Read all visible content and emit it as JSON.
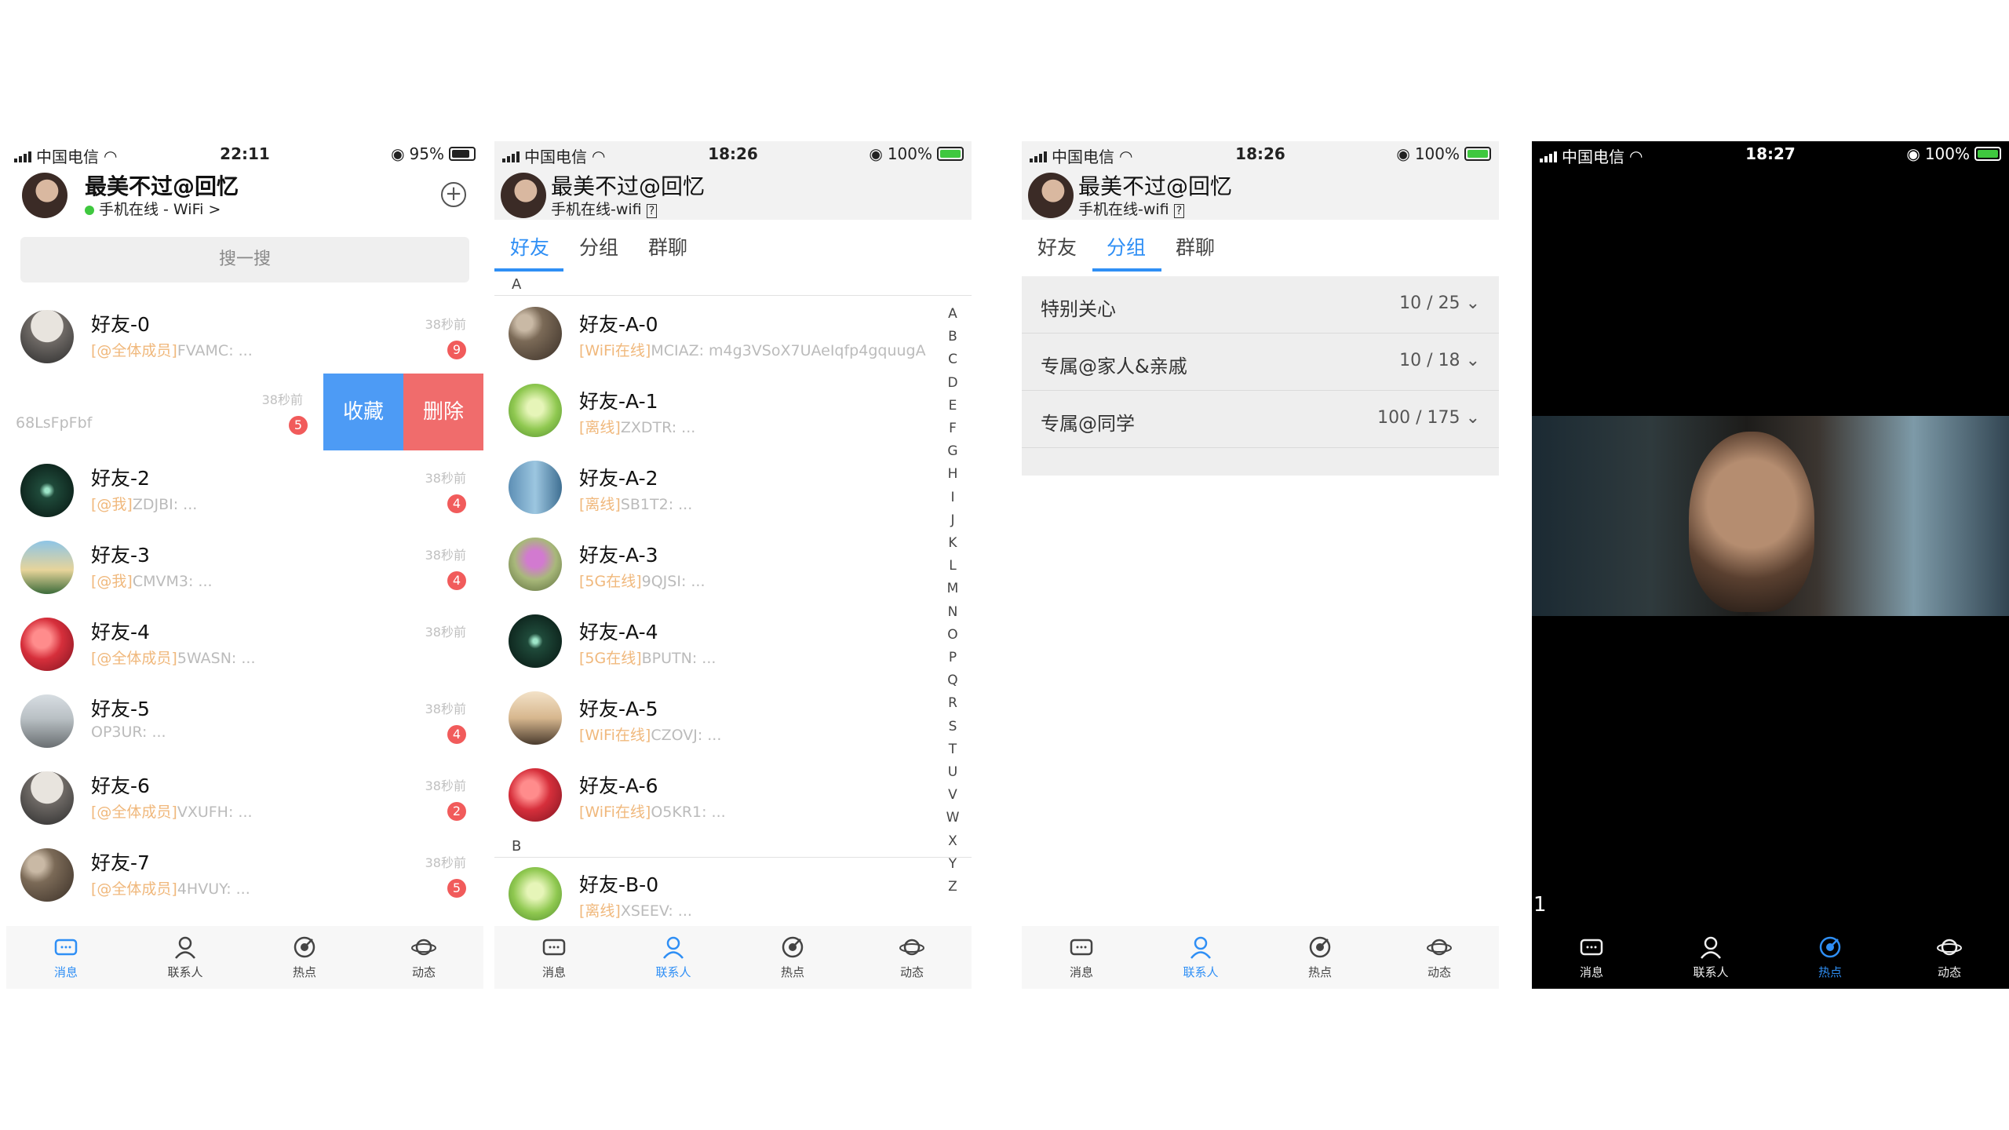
{
  "screen1": {
    "status": {
      "carrier": "中国电信",
      "time": "22:11",
      "battery": "95%"
    },
    "header": {
      "name": "最美不过@回忆",
      "status": "手机在线 - WiFi >"
    },
    "search_placeholder": "搜一搜",
    "messages": [
      {
        "name": "好友-0",
        "tag": "[@全体成员]",
        "text": "FVAMC: ...",
        "time": "38秒前",
        "badge": "9"
      },
      {
        "name": "",
        "tag": "",
        "text": "68LsFpFbf",
        "time": "38秒前",
        "badge": "5"
      },
      {
        "name": "好友-2",
        "tag": "[@我]",
        "text": "ZDJBI: ...",
        "time": "38秒前",
        "badge": "4"
      },
      {
        "name": "好友-3",
        "tag": "[@我]",
        "text": "CMVM3: ...",
        "time": "38秒前",
        "badge": "4"
      },
      {
        "name": "好友-4",
        "tag": "[@全体成员]",
        "text": "5WASN: ...",
        "time": "38秒前",
        "badge": ""
      },
      {
        "name": "好友-5",
        "tag": "",
        "text": "OP3UR: ...",
        "time": "38秒前",
        "badge": "4"
      },
      {
        "name": "好友-6",
        "tag": "[@全体成员]",
        "text": "VXUFH: ...",
        "time": "38秒前",
        "badge": "2"
      },
      {
        "name": "好友-7",
        "tag": "[@全体成员]",
        "text": "4HVUY: ...",
        "time": "38秒前",
        "badge": "5"
      }
    ],
    "swipe": {
      "collect": "收藏",
      "delete": "删除"
    }
  },
  "screen2": {
    "status": {
      "carrier": "中国电信",
      "time": "18:26",
      "battery": "100%"
    },
    "header": {
      "name": "最美不过@回忆",
      "status": "手机在线-wifi",
      "help": "?"
    },
    "tabs": [
      "好友",
      "分组",
      "群聊"
    ],
    "section_a": "A",
    "section_b": "B",
    "friends": [
      {
        "name": "好友-A-0",
        "tag": "[WiFi在线]",
        "text": "MCIAZ: m4g3VSoX7UAeIqfp4gquugA"
      },
      {
        "name": "好友-A-1",
        "tag": "[离线]",
        "text": "ZXDTR: ..."
      },
      {
        "name": "好友-A-2",
        "tag": "[离线]",
        "text": "SB1T2: ..."
      },
      {
        "name": "好友-A-3",
        "tag": "[5G在线]",
        "text": "9QJSI: ..."
      },
      {
        "name": "好友-A-4",
        "tag": "[5G在线]",
        "text": "BPUTN: ..."
      },
      {
        "name": "好友-A-5",
        "tag": "[WiFi在线]",
        "text": "CZOVJ: ..."
      },
      {
        "name": "好友-A-6",
        "tag": "[WiFi在线]",
        "text": "O5KR1: ..."
      },
      {
        "name": "好友-B-0",
        "tag": "[离线]",
        "text": "XSEEV: ..."
      }
    ],
    "index": [
      "A",
      "B",
      "C",
      "D",
      "E",
      "F",
      "G",
      "H",
      "I",
      "J",
      "K",
      "L",
      "M",
      "N",
      "O",
      "P",
      "Q",
      "R",
      "S",
      "T",
      "U",
      "V",
      "W",
      "X",
      "Y",
      "Z"
    ]
  },
  "screen3": {
    "status": {
      "carrier": "中国电信",
      "time": "18:26",
      "battery": "100%"
    },
    "header": {
      "name": "最美不过@回忆",
      "status": "手机在线-wifi",
      "help": "?"
    },
    "tabs": [
      "好友",
      "分组",
      "群聊"
    ],
    "groups": [
      {
        "name": "特别关心",
        "count": "10 / 25"
      },
      {
        "name": "专属@家人&亲戚",
        "count": "10 / 18"
      },
      {
        "name": "专属@同学",
        "count": "100 / 175"
      }
    ]
  },
  "screen4": {
    "status": {
      "carrier": "中国电信",
      "time": "18:27",
      "battery": "100%"
    },
    "page_number": "1"
  },
  "tabbar": [
    "消息",
    "联系人",
    "热点",
    "动态"
  ],
  "colors": {
    "accent": "#2f8ff5",
    "badge": "#f15b5b",
    "tag": "#f0b87c",
    "collect": "#4d9bf5",
    "delete": "#f06c6c",
    "online": "#3fc83f"
  },
  "icons": {
    "chevron": "chevron-down-icon",
    "add": "plus-circle-icon"
  }
}
